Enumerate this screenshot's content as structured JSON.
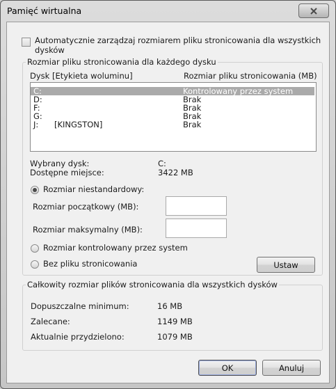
{
  "window": {
    "title": "Pamięć wirtualna",
    "close_icon": "close-icon"
  },
  "auto_manage": {
    "label_line1": "Automatycznie zarządzaj rozmiarem pliku stronicowania dla wszystkich",
    "label_line2": "dysków",
    "checked": false
  },
  "per_drive": {
    "legend": "Rozmiar pliku stronicowania dla każdego dysku",
    "col_drive": "Dysk [Etykieta woluminu]",
    "col_size": "Rozmiar pliku stronicowania (MB)",
    "drives": [
      {
        "drive": "C:",
        "label": "",
        "size": "Kontrolowany przez system",
        "selected": true
      },
      {
        "drive": "D:",
        "label": "",
        "size": "Brak",
        "selected": false
      },
      {
        "drive": "F:",
        "label": "",
        "size": "Brak",
        "selected": false
      },
      {
        "drive": "G:",
        "label": "",
        "size": "Brak",
        "selected": false
      },
      {
        "drive": "J:",
        "label": "[KINGSTON]",
        "size": "Brak",
        "selected": false
      }
    ],
    "selected_drive_label": "Wybrany dysk:",
    "selected_drive_value": "C:",
    "free_space_label": "Dostępne miejsce:",
    "free_space_value": "3422 MB",
    "custom_size_label": "Rozmiar niestandardowy:",
    "initial_size_label": "Rozmiar początkowy (MB):",
    "initial_size_value": "",
    "max_size_label": "Rozmiar maksymalny (MB):",
    "max_size_value": "",
    "system_managed_label": "Rozmiar kontrolowany przez system",
    "no_paging_label": "Bez pliku stronicowania",
    "selected_option": "custom",
    "set_button": "Ustaw"
  },
  "totals": {
    "legend": "Całkowity rozmiar plików stronicowania dla wszystkich dysków",
    "min_label": "Dopuszczalne minimum:",
    "min_value": "16 MB",
    "recommended_label": "Zalecane:",
    "recommended_value": "1149 MB",
    "current_label": "Aktualnie przydzielono:",
    "current_value": "1079 MB"
  },
  "buttons": {
    "ok": "OK",
    "cancel": "Anuluj"
  }
}
